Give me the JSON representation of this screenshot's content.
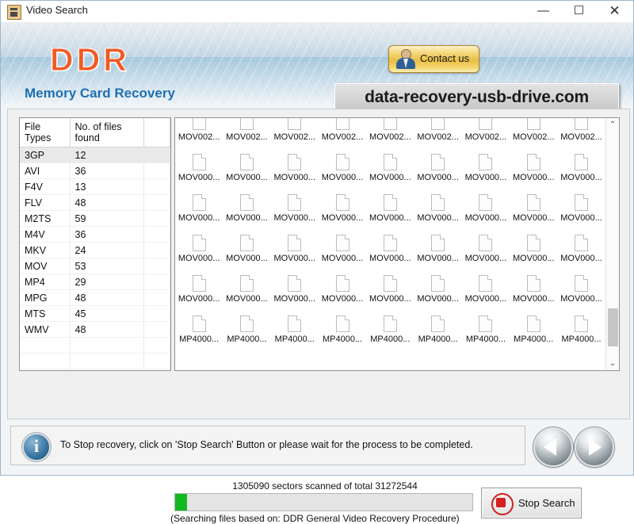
{
  "window": {
    "title": "Video Search",
    "icon": "app-icon",
    "minimize": "—",
    "maximize": "☐",
    "close": "✕"
  },
  "banner": {
    "logo": "DDR",
    "subtitle": "Memory Card Recovery",
    "contact_label": "Contact us",
    "url": "data-recovery-usb-drive.com",
    "accent_color": "#f15a24",
    "subtitle_color": "#1f6fb2"
  },
  "file_table": {
    "headers": [
      "File Types",
      "No. of files found",
      ""
    ],
    "rows": [
      {
        "type": "3GP",
        "count": "12"
      },
      {
        "type": "AVI",
        "count": "36"
      },
      {
        "type": "F4V",
        "count": "13"
      },
      {
        "type": "FLV",
        "count": "48"
      },
      {
        "type": "M2TS",
        "count": "59"
      },
      {
        "type": "M4V",
        "count": "36"
      },
      {
        "type": "MKV",
        "count": "24"
      },
      {
        "type": "MOV",
        "count": "53"
      },
      {
        "type": "MP4",
        "count": "29"
      },
      {
        "type": "MPG",
        "count": "48"
      },
      {
        "type": "MTS",
        "count": "45"
      },
      {
        "type": "WMV",
        "count": "48"
      }
    ],
    "empty_rows": 6,
    "selected_row_index": 0
  },
  "file_grid": {
    "columns": 9,
    "rows": [
      {
        "label": "MOV002..."
      },
      {
        "label": "MOV000..."
      },
      {
        "label": "MOV000..."
      },
      {
        "label": "MOV000..."
      },
      {
        "label": "MOV000..."
      },
      {
        "label": "MP4000..."
      }
    ],
    "scrollbar": {
      "up": "⌃",
      "down": "⌄"
    }
  },
  "progress": {
    "scan_text": "1305090  sectors scanned of total 31272544",
    "sectors_scanned": 1305090,
    "sectors_total": 31272544,
    "percent": 4,
    "fill_color": "#12b822",
    "based_on": "(Searching files based on:  DDR General Video Recovery Procedure)"
  },
  "stop_button": {
    "label": "Stop Search",
    "icon": "stop-icon"
  },
  "footer": {
    "message": "To Stop recovery, click on 'Stop Search' Button or please wait for the process to be completed.",
    "info_icon": "info-icon",
    "prev_icon": "arrow-left-icon",
    "next_icon": "arrow-right-icon"
  }
}
